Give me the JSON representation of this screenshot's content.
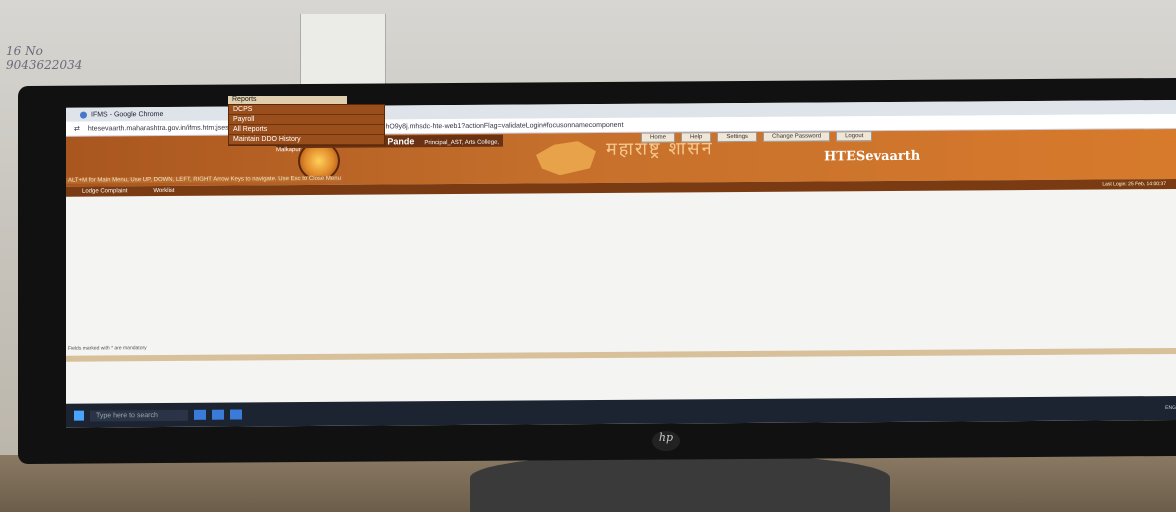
{
  "window": {
    "title": "IFMS - Google Chrome",
    "url": "htesevaarth.maharashtra.gov.in/ifms.htm;jsessionid=M10QcpfeSnOMW-0-Mop04J23cOn4y-v4ShO9y8j.mhsdc-hte-web1?actionFlag=validateLogin#focusonnamecomponent"
  },
  "header": {
    "welcome": "Welcome Ms Dr. Gitali S. Pande",
    "role": "Principal_AST, Arts College,",
    "location": "Malkapur",
    "brand": "HTESevaarth",
    "marathi": "महाराष्ट्र शासन",
    "nav": [
      "Home",
      "Help",
      "Settings",
      "Change Password",
      "Logout"
    ]
  },
  "menu": {
    "hint": "ALT+M for Main Menu, Use UP, DOWN, LEFT, RIGHT Arrow Keys to navigate. Use Esc to Close Menu",
    "items": [
      "Lodge Complaint",
      "Worklist",
      "Reports"
    ],
    "last_login": "Last Login: 25 Feb, 14:00:37"
  },
  "reports_dropdown": [
    "DCPS",
    "Payroll",
    "All Reports",
    "Maintain DDO History"
  ],
  "footer_hint": "Fields marked with * are mandatory",
  "taskbar": {
    "search_placeholder": "Type here to search",
    "tray": "ENG"
  },
  "monitor_brand": "hp"
}
